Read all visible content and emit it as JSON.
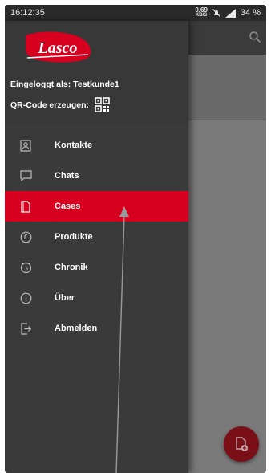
{
  "status_bar": {
    "time": "16:12:35",
    "net_speed_value": "0,69",
    "net_speed_unit": "KB/S",
    "battery": "34 %"
  },
  "drawer": {
    "logo_text": "Lasco",
    "logged_in_label": "Eingeloggt als: Testkunde1",
    "qr_label": "QR-Code erzeugen:",
    "items": [
      {
        "label": "Kontakte",
        "icon": "contacts-icon"
      },
      {
        "label": "Chats",
        "icon": "chat-icon"
      },
      {
        "label": "Cases",
        "icon": "case-icon",
        "active": true
      },
      {
        "label": "Produkte",
        "icon": "products-icon"
      },
      {
        "label": "Chronik",
        "icon": "history-icon"
      },
      {
        "label": "Über",
        "icon": "info-icon"
      },
      {
        "label": "Abmelden",
        "icon": "logout-icon"
      }
    ]
  },
  "colors": {
    "accent": "#d7001e",
    "drawer_bg": "#3a3a3a",
    "fab": "#7a0f18"
  }
}
